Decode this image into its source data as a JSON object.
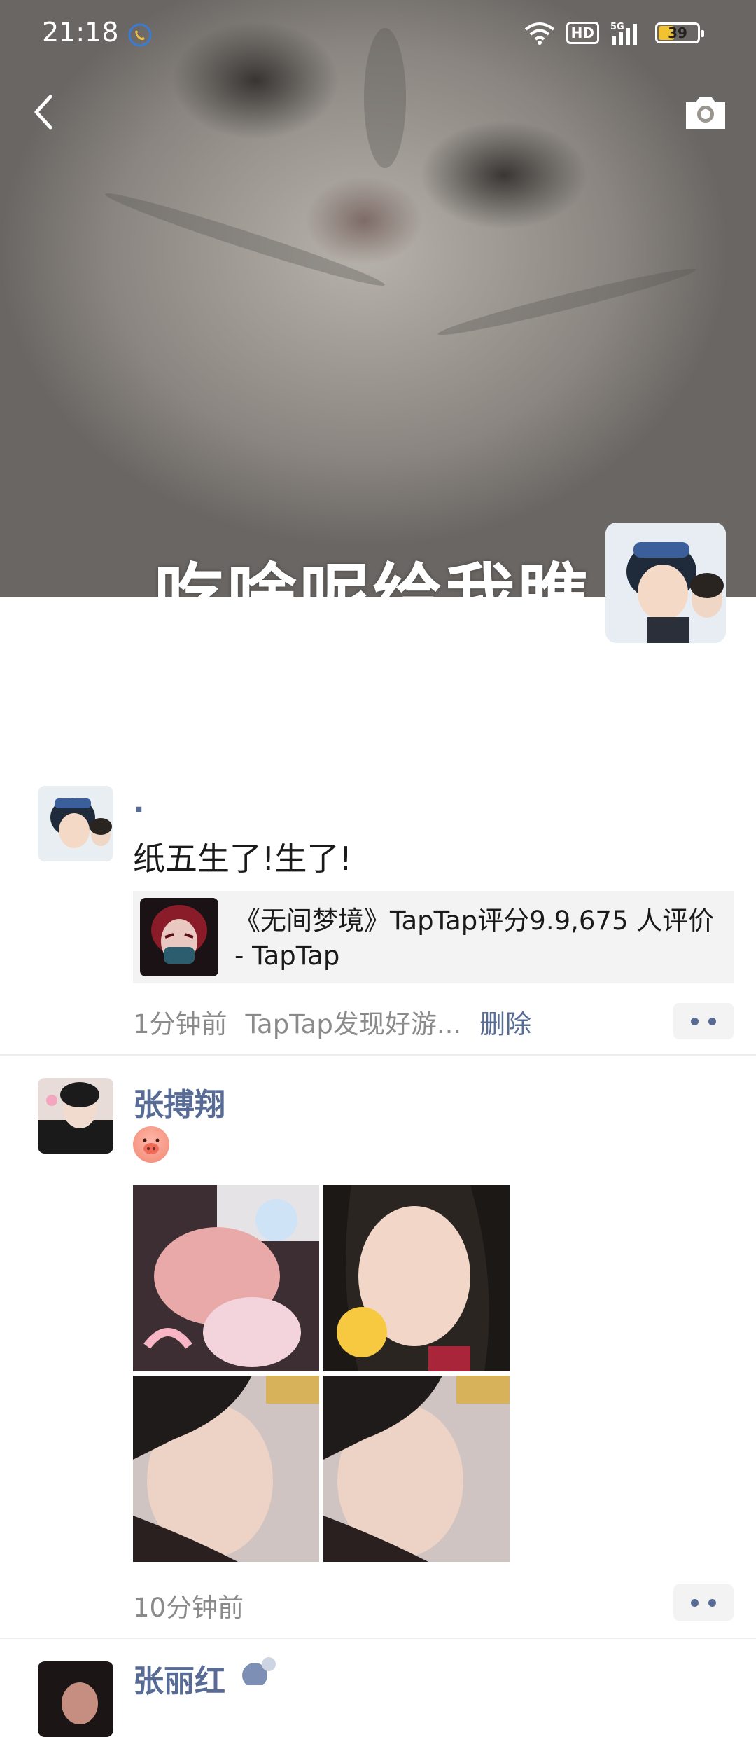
{
  "status_bar": {
    "time": "21:18",
    "network_badge": "HD",
    "cellular": "5G",
    "battery_level": "39"
  },
  "cover": {
    "caption_text": "吃啥呢给我瞧"
  },
  "posts": [
    {
      "nickname": ".",
      "text": "纸五生了!生了!",
      "link_card": {
        "title": "《无间梦境》TapTap评分9.9,675 人评价 - TapTap"
      },
      "time_ago": "1分钟前",
      "source": "TapTap发现好游...",
      "delete_label": "删除"
    },
    {
      "nickname": "张搏翔",
      "emoji_icon": "pig-face-icon",
      "time_ago": "10分钟前",
      "photos_count": 4
    },
    {
      "nickname": "张丽红"
    }
  ],
  "icons": {
    "back": "chevron-left-icon",
    "camera": "camera-icon",
    "more": "more-dots-icon"
  },
  "colors": {
    "link_blue": "#576b95",
    "meta_gray": "#8a8a8a",
    "card_bg": "#f3f3f3"
  }
}
